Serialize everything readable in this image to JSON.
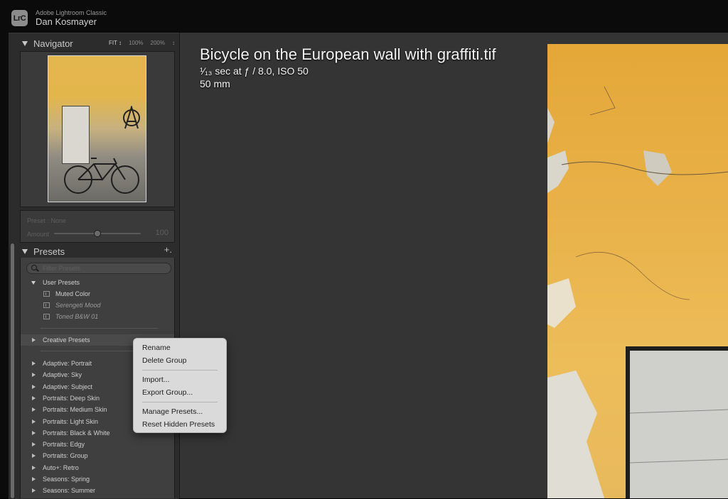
{
  "titlebar": {
    "logo": "LrC",
    "app_name": "Adobe Lightroom Classic",
    "user_name": "Dan Kosmayer"
  },
  "navigator": {
    "title": "Navigator",
    "zoom_options": [
      "FIT ↕",
      "100%",
      "200%",
      "↕"
    ]
  },
  "preset_amount": {
    "preset_label": "Preset : None",
    "amount_label": "Amount",
    "amount_value": "100",
    "amount_fraction": 0.5
  },
  "presets": {
    "title": "Presets",
    "add_icon": "plus-icon",
    "add_label": "+.",
    "filter_placeholder": "Filter Presets",
    "user_group": "User Presets",
    "user_items": [
      {
        "label": "Muted Color",
        "style": "normal"
      },
      {
        "label": "Serengeti Mood",
        "style": "italic"
      },
      {
        "label": "Toned B&W 01",
        "style": "italic"
      }
    ],
    "creative_group": "Creative Presets",
    "groups": [
      "Adaptive: Portrait",
      "Adaptive: Sky",
      "Adaptive: Subject",
      "Portraits: Deep Skin",
      "Portraits: Medium Skin",
      "Portraits: Light Skin",
      "Portraits: Black & White",
      "Portraits: Edgy",
      "Portraits: Group",
      "Auto+: Retro",
      "Seasons: Spring",
      "Seasons: Summer"
    ]
  },
  "info": {
    "title": "Bicycle on the European wall with graffiti.tif",
    "exif": "¹⁄₁₃ sec at ƒ / 8.0, ISO 50",
    "focal": "50 mm"
  },
  "context_menu": {
    "items": [
      "Rename",
      "Delete Group",
      "Import...",
      "Export Group...",
      "Manage Presets...",
      "Reset Hidden Presets"
    ]
  },
  "colors": {
    "panel_bg": "#2c2c2c",
    "main_bg": "#343434",
    "photo_accent": "#e4a738"
  }
}
